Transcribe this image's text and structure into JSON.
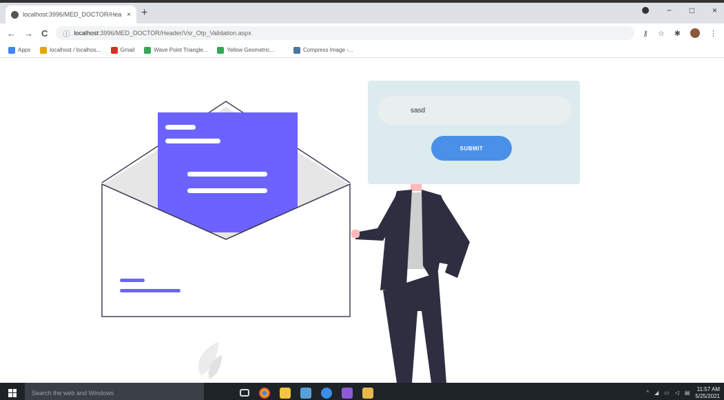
{
  "browser": {
    "tab_title": "localhost:3996/MED_DOCTOR/Hea",
    "tab_close": "×",
    "new_tab": "+",
    "url": "localhost:3996/MED_DOCTOR/Header/Vsr_Otp_Validation.aspx",
    "url_host": "localhost",
    "url_rest": ":3996/MED_DOCTOR/Header/Vsr_Otp_Validation.aspx",
    "back": "←",
    "forward": "→",
    "reload": "C",
    "window_minimize": "−",
    "window_maximize": "□",
    "window_close": "×"
  },
  "bookmarks": [
    {
      "label": "Apps",
      "color": "#4285f4"
    },
    {
      "label": "localhost / localhos...",
      "color": "#e8a400"
    },
    {
      "label": "Gmail",
      "color": "#d93025"
    },
    {
      "label": "Wave Point Triangle...",
      "color": "#34a853"
    },
    {
      "label": "Yellow Geometric...",
      "color": "#34a853"
    },
    {
      "label": "Compress Image -...",
      "color": "#4a76a8"
    }
  ],
  "form": {
    "otp_value": "sasd",
    "submit_label": "SUBMIT"
  },
  "colors": {
    "accent_purple": "#6c63ff",
    "button_blue": "#4a90e8",
    "card_bg": "#dcebed",
    "suit_dark": "#2f2e41"
  },
  "taskbar": {
    "search_placeholder": "Search the web and Windows",
    "time": "11:57 AM",
    "date": "5/25/2021"
  }
}
